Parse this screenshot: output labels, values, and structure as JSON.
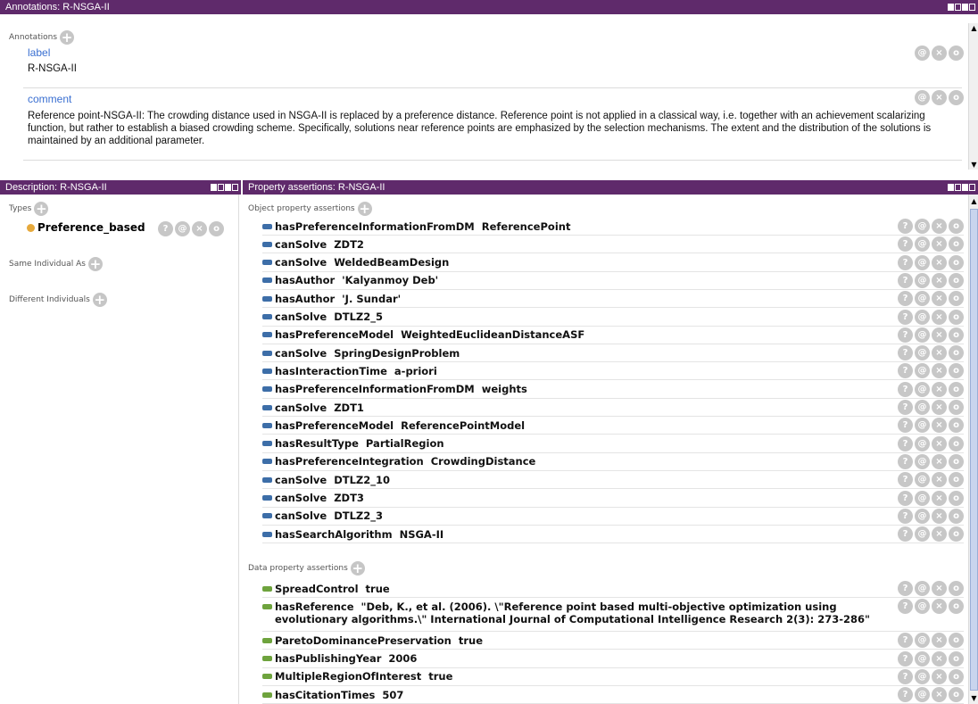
{
  "annotations_view": {
    "title": "Annotations: R-NSGA-II",
    "section_label": "Annotations",
    "items": [
      {
        "property": "label",
        "value": "R-NSGA-II"
      },
      {
        "property": "comment",
        "value": "Reference point-NSGA-II: The crowding distance used in NSGA-II is replaced by a preference distance.  Reference point is not applied in a classical way, i.e. together with an achievement scalarizing function, but rather to establish a biased crowding scheme. Specifically, solutions near reference points are emphasized by the selection mechanisms. The extent and the distribution of the solutions is maintained by an additional parameter."
      }
    ]
  },
  "description_view": {
    "title": "Description: R-NSGA-II",
    "types_label": "Types",
    "type_value": "Preference_based",
    "same_individual_label": "Same Individual As",
    "different_individuals_label": "Different Individuals"
  },
  "property_view": {
    "title": "Property assertions: R-NSGA-II",
    "object_label": "Object property assertions",
    "object_assertions": [
      "hasPreferenceInformationFromDM  ReferencePoint",
      "canSolve  ZDT2",
      "canSolve  WeldedBeamDesign",
      "hasAuthor  'Kalyanmoy Deb'",
      "hasAuthor  'J. Sundar'",
      "canSolve  DTLZ2_5",
      "hasPreferenceModel  WeightedEuclideanDistanceASF",
      "canSolve  SpringDesignProblem",
      "hasInteractionTime  a-priori",
      "hasPreferenceInformationFromDM  weights",
      "canSolve  ZDT1",
      "hasPreferenceModel  ReferencePointModel",
      "hasResultType  PartialRegion",
      "hasPreferenceIntegration  CrowdingDistance",
      "canSolve  DTLZ2_10",
      "canSolve  ZDT3",
      "canSolve  DTLZ2_3",
      "hasSearchAlgorithm  NSGA-II"
    ],
    "data_label": "Data property assertions",
    "data_assertions": [
      "SpreadControl  true",
      "hasReference  \"Deb, K., et al. (2006). \\\"Reference point based multi-objective optimization using\nevolutionary algorithms.\\\" International Journal of Computational Intelligence Research 2(3): 273-286\"",
      "ParetoDominancePreservation  true",
      "hasPublishingYear  2006",
      "MultipleRegionOfInterest  true",
      "hasCitationTimes  507"
    ]
  },
  "icons": {
    "add": "+",
    "explain": "?",
    "annotate": "@",
    "delete": "×",
    "edit": "o"
  },
  "colors": {
    "title_bar": "#5f2a6b",
    "annotation_property": "#3a6fd1",
    "object_property": "#3d6ea8",
    "data_property": "#6ea33d",
    "type_dot": "#e6a93c"
  }
}
